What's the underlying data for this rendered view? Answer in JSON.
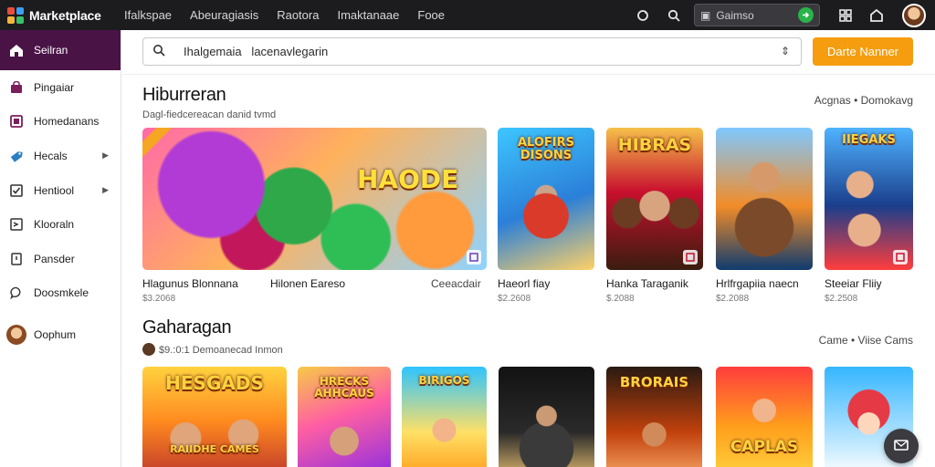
{
  "app": {
    "name": "Marketplace"
  },
  "topnav": [
    "Ifalkspae",
    "Abeuragiasis",
    "Raotora",
    "Imaktanaae",
    "Fooe"
  ],
  "top_search": {
    "placeholder": "Gaimso"
  },
  "sidebar": {
    "items": [
      {
        "label": "Seilran",
        "icon": "home-icon",
        "active": true
      },
      {
        "label": "Pingaiar",
        "icon": "bag-icon"
      },
      {
        "label": "Homedanans",
        "icon": "picture-icon"
      },
      {
        "label": "Hecals",
        "icon": "tag-icon",
        "chevron": true
      },
      {
        "label": "Hentiool",
        "icon": "checkbox-icon",
        "chevron": true
      },
      {
        "label": "Klooraln",
        "icon": "arrow-box-icon"
      },
      {
        "label": "Pansder",
        "icon": "page-icon"
      },
      {
        "label": "Doosmkele",
        "icon": "chat-icon"
      },
      {
        "label": "Oophum",
        "icon": "avatar"
      }
    ]
  },
  "search": {
    "value": "Ihalgemaia   lacenavlegarin",
    "sort_glyph": "⇕"
  },
  "cta": {
    "label": "Darte Nanner"
  },
  "section1": {
    "title": "Hiburreran",
    "subtitle": "Dagl-fiedcereacan danid tvmd",
    "link": "Acgnas • Domokavg",
    "cards": [
      {
        "name": "feature",
        "headline": "HAODE",
        "title": "Hlagunus Blonnana",
        "title2": "Hilonen Eareso",
        "title3": "Ceeacdair",
        "price": "$3.2068",
        "colors": [
          "#ff5fa2",
          "#ffb347",
          "#8fd3ff"
        ]
      },
      {
        "name": "card-2",
        "headline": "ALOFIRS DISONS",
        "title": "Haeorl fiay",
        "price": "$2.2608",
        "colors": [
          "#3ec6ff",
          "#ff7a3a",
          "#ffd166"
        ]
      },
      {
        "name": "card-3",
        "headline": "HIBRAS",
        "title": "Hanka Taraganik",
        "price": "$.2088",
        "colors": [
          "#c8102e",
          "#3a1c0e",
          "#f5c04a"
        ]
      },
      {
        "name": "card-4",
        "headline": "",
        "title": "Hrlfrgapiia naecn",
        "price": "$2.2088",
        "colors": [
          "#0f3b6e",
          "#f28c28",
          "#7ec8ff"
        ]
      },
      {
        "name": "card-5",
        "headline": "IIEGAKS",
        "title": "Steeiar Fliiy",
        "price": "$2.2508",
        "colors": [
          "#1a3e8c",
          "#4fb3ff",
          "#ff3d3d"
        ]
      }
    ]
  },
  "section2": {
    "title": "Gaharagan",
    "subtitle": "$9.:0:1  Demoanecad Inmon",
    "link": "Came • Viise Cams",
    "cards": [
      {
        "name": "g-card-1",
        "headline": "HESGADS",
        "sub": "RAIIDHE CAMES",
        "colors": [
          "#ff8a1f",
          "#ffd23f",
          "#c0392b"
        ]
      },
      {
        "name": "g-card-2",
        "headline": "HRECKS AHHCAUS",
        "colors": [
          "#8e2de2",
          "#ff5fa2",
          "#f7c948"
        ]
      },
      {
        "name": "g-card-3",
        "headline": "BIRIGOS",
        "colors": [
          "#2ec4ff",
          "#ff9f1c",
          "#ffe066"
        ]
      },
      {
        "name": "g-card-4",
        "headline": "",
        "colors": [
          "#121212",
          "#3a3a3a",
          "#d8b36a"
        ]
      },
      {
        "name": "g-card-5",
        "headline": "BRORAIS",
        "colors": [
          "#2a1a12",
          "#c2410c",
          "#f4a261"
        ]
      },
      {
        "name": "g-card-6",
        "headline": "CAPLAS",
        "colors": [
          "#ff3d3d",
          "#ff9f1c",
          "#ffd23f"
        ]
      },
      {
        "name": "g-card-7",
        "headline": "",
        "colors": [
          "#35b6ff",
          "#ffffff",
          "#e63946"
        ]
      }
    ]
  },
  "colors": {
    "topbar": "#1c1c1f",
    "accent": "#4a1346",
    "cta": "#f59d0e"
  }
}
